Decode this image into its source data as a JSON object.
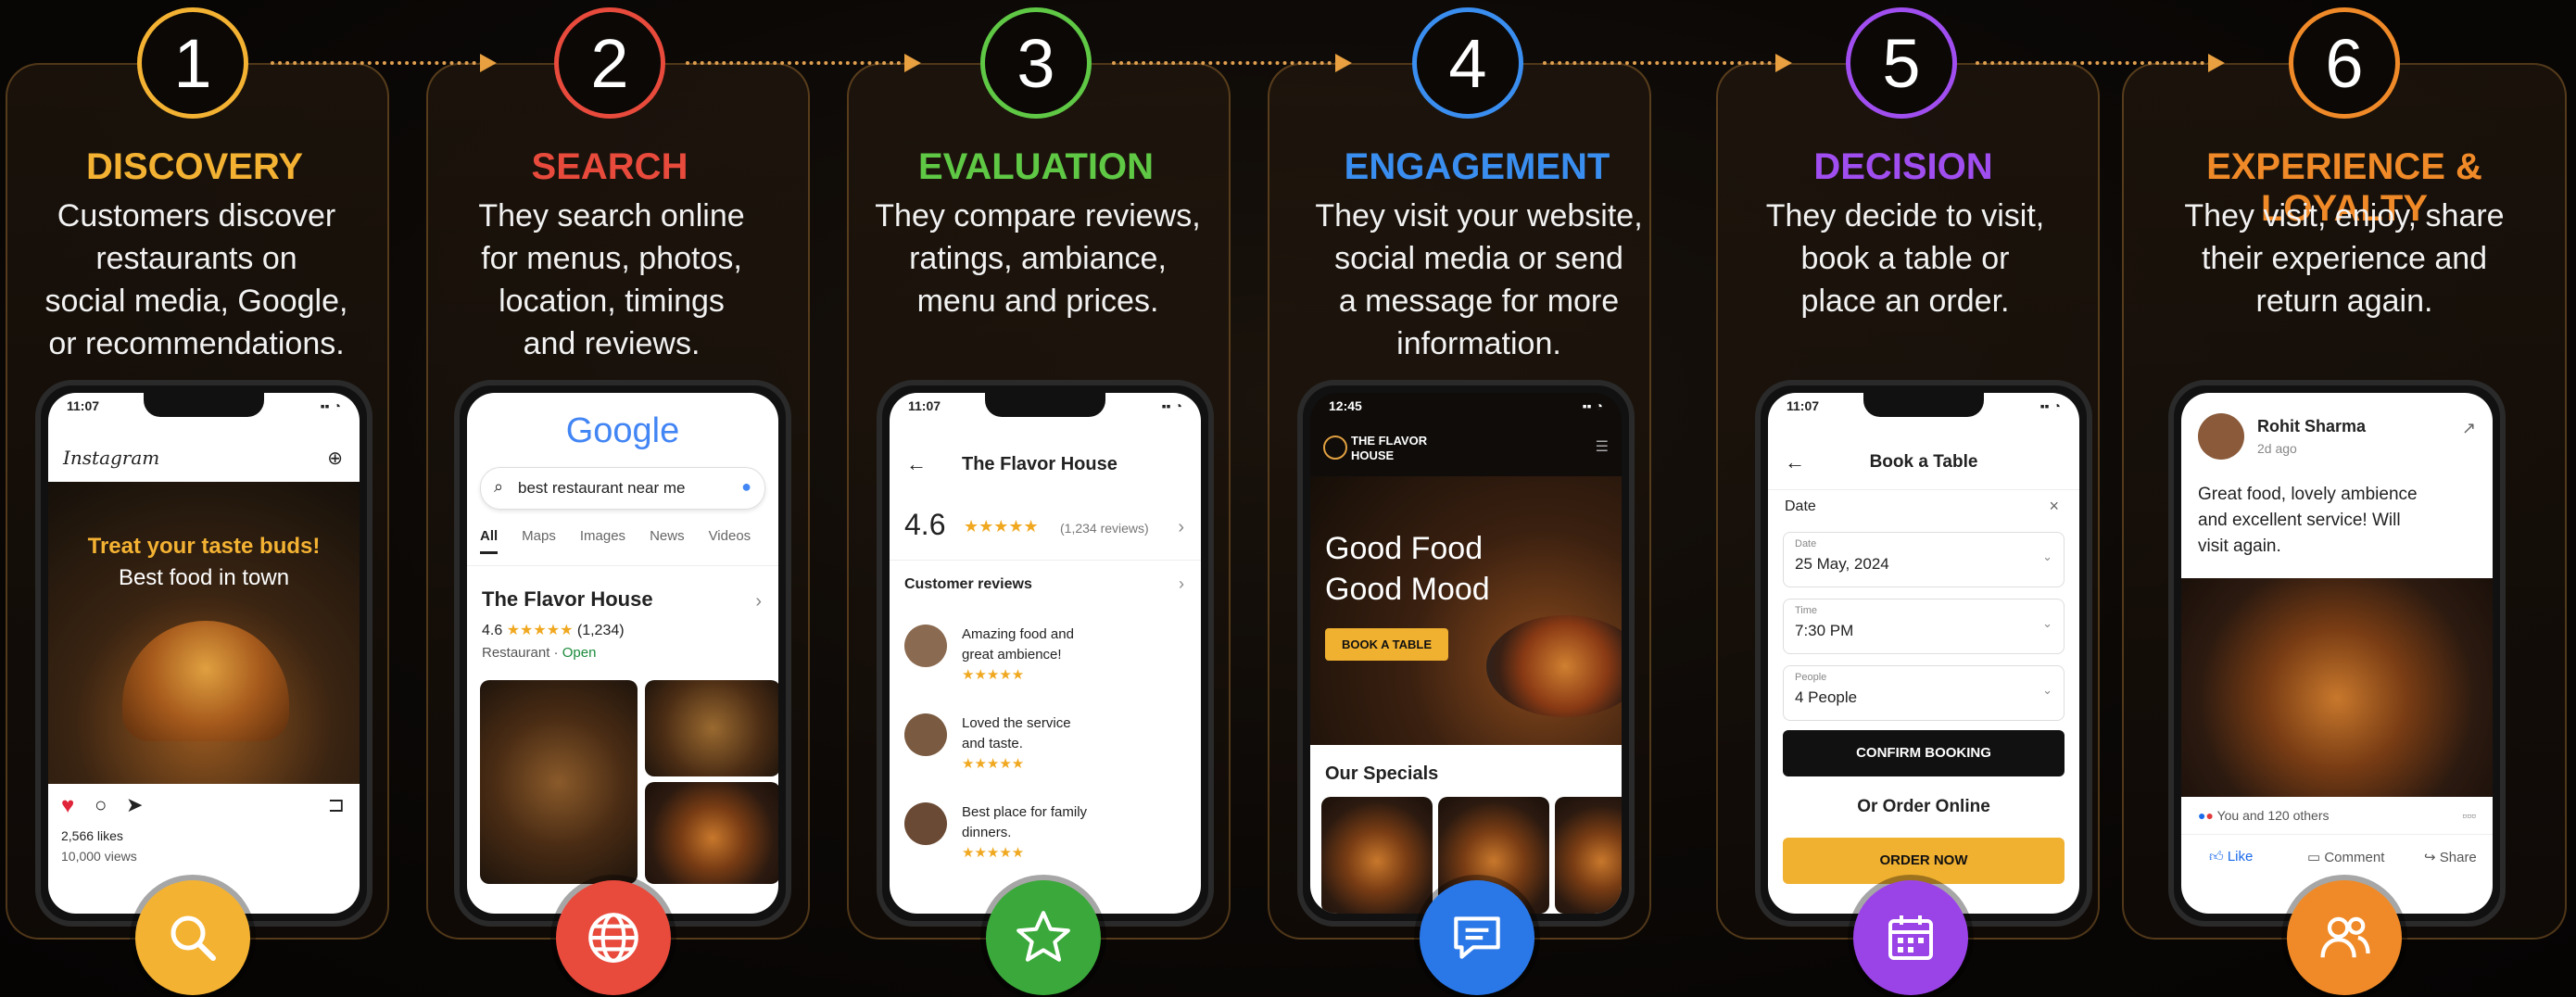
{
  "stages": [
    {
      "num": "1",
      "title": "DISCOVERY",
      "color": "#f4b233",
      "desc": [
        "Customers discover",
        "restaurants on",
        "social media, Google,",
        "or recommendations."
      ],
      "icon": "search-icon"
    },
    {
      "num": "2",
      "title": "SEARCH",
      "color": "#e84a3c",
      "desc": [
        "They search online",
        "for menus, photos,",
        "location, timings",
        "and reviews."
      ],
      "icon": "globe-icon"
    },
    {
      "num": "3",
      "title": "EVALUATION",
      "color": "#5fc845",
      "desc": [
        "They compare reviews,",
        "ratings, ambiance,",
        "menu and prices."
      ],
      "icon": "star-icon"
    },
    {
      "num": "4",
      "title": "ENGAGEMENT",
      "color": "#3a8ef0",
      "desc": [
        "They visit your website,",
        "social media or send",
        "a message for more",
        "information."
      ],
      "icon": "chat-icon"
    },
    {
      "num": "5",
      "title": "DECISION",
      "color": "#a04ef0",
      "desc": [
        "They decide to visit,",
        "book a table or",
        "place an order."
      ],
      "icon": "calendar-icon"
    },
    {
      "num": "6",
      "title": "EXPERIENCE & LOYALTY",
      "color": "#f08a28",
      "desc": [
        "They visit, enjoy, share",
        "their experience and",
        "return again."
      ],
      "icon": "users-icon"
    }
  ],
  "phone1": {
    "time": "11:07",
    "app": "Instagram",
    "promo1": "Treat your taste buds!",
    "promo2": "Best food in town",
    "likes": "2,566 likes",
    "views": "10,000 views"
  },
  "phone2": {
    "logo": "Google",
    "query": "best restaurant near me",
    "tabs": [
      "All",
      "Maps",
      "Images",
      "News",
      "Videos"
    ],
    "name": "The Flavor House",
    "rating": "4.6",
    "count": "(1,234)",
    "type": "Restaurant",
    "status": "Open"
  },
  "phone3": {
    "time": "11:07",
    "name": "The Flavor House",
    "rating": "4.6",
    "count": "(1,234 reviews)",
    "section": "Customer reviews",
    "reviews": [
      [
        "Amazing food and",
        "great ambience!"
      ],
      [
        "Loved the service",
        "and taste."
      ],
      [
        "Best place for family",
        "dinners."
      ]
    ]
  },
  "phone4": {
    "time": "12:45",
    "brand1": "THE FLAVOR",
    "brand2": "HOUSE",
    "hero1": "Good Food",
    "hero2": "Good Mood",
    "cta": "BOOK A TABLE",
    "specials": "Our Specials"
  },
  "phone5": {
    "time": "11:07",
    "title": "Book a Table",
    "date_label": "Date",
    "date_small": "Date",
    "date": "25 May, 2024",
    "time_small": "Time",
    "time_val": "7:30 PM",
    "people_small": "People",
    "people": "4 People",
    "confirm": "CONFIRM BOOKING",
    "or": "Or Order Online",
    "order": "ORDER NOW"
  },
  "phone6": {
    "user": "Rohit Sharma",
    "ago": "2d ago",
    "post": [
      "Great food, lovely ambience",
      "and excellent service! Will",
      "visit again."
    ],
    "reacts": "You and 120 others",
    "like": "Like",
    "comment": "Comment",
    "share": "Share"
  },
  "stars": "★★★★★"
}
